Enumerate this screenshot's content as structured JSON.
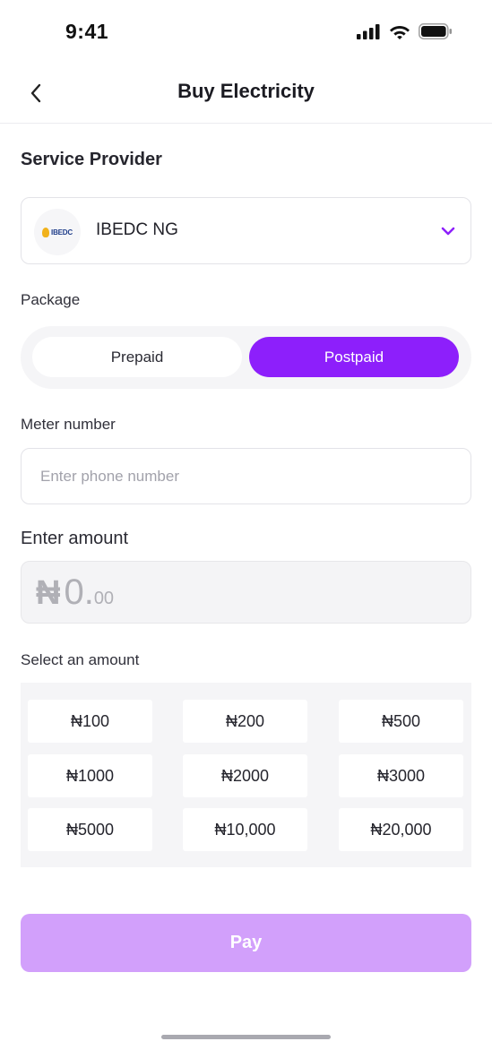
{
  "status_bar": {
    "time": "9:41",
    "icons": [
      "signal-icon",
      "wifi-icon",
      "battery-icon"
    ]
  },
  "header": {
    "back_icon": "chevron-left-icon",
    "title": "Buy Electricity"
  },
  "service_provider": {
    "heading": "Service Provider",
    "logo_text": "IBEDC",
    "selected": "IBEDC NG",
    "dropdown_icon": "chevron-down-icon"
  },
  "package": {
    "label": "Package",
    "options": [
      "Prepaid",
      "Postpaid"
    ],
    "selected": "Postpaid"
  },
  "meter": {
    "label": "Meter number",
    "placeholder": "Enter phone number",
    "value": ""
  },
  "amount": {
    "label": "Enter amount",
    "currency": "₦",
    "main": "0.",
    "decimal": "00"
  },
  "quick_amounts": {
    "label": "Select an amount",
    "options": [
      "₦100",
      "₦200",
      "₦500",
      "₦1000",
      "₦2000",
      "₦3000",
      "₦5000",
      "₦10,000",
      "₦20,000"
    ]
  },
  "pay_button": {
    "label": "Pay"
  },
  "colors": {
    "accent": "#8d1ffb",
    "pay_disabled": "#d2a0fb",
    "field_border": "#e3e3e8",
    "muted_bg": "#f5f5f7"
  }
}
